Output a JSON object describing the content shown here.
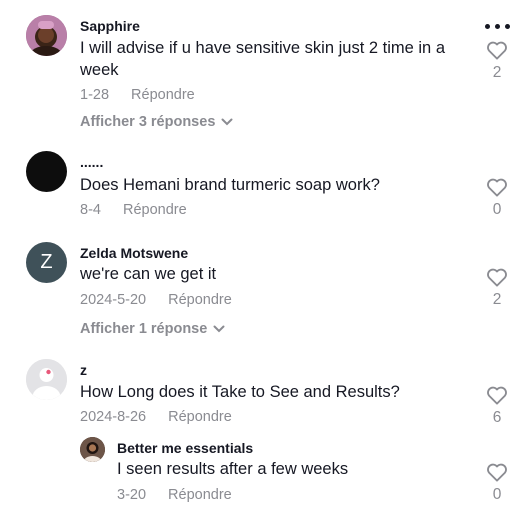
{
  "comments": [
    {
      "username": "Sapphire",
      "text": "I will advise if u have sensitive skin just 2 time in a week",
      "date": "1-28",
      "reply_label": "Répondre",
      "likes": "2",
      "view_replies": "Afficher 3 réponses",
      "avatar_icon": "user-photo"
    },
    {
      "username": "......",
      "text": "Does Hemani brand turmeric soap work?",
      "date": "8-4",
      "reply_label": "Répondre",
      "likes": "0",
      "avatar_icon": "black-circle"
    },
    {
      "username": "Zelda Motswene",
      "avatar_letter": "Z",
      "text": "we're can we get it",
      "date": "2024-5-20",
      "reply_label": "Répondre",
      "likes": "2",
      "view_replies": "Afficher 1 réponse",
      "avatar_color": "#3f5159"
    },
    {
      "username": "z",
      "text": "How Long does it Take to See and Results?",
      "date": "2024-8-26",
      "reply_label": "Répondre",
      "likes": "6",
      "avatar_icon": "default-avatar"
    }
  ],
  "reply": {
    "username": "Better me essentials",
    "text": "I seen results after a few weeks",
    "date": "3-20",
    "reply_label": "Répondre",
    "likes": "0",
    "avatar_icon": "user-photo"
  },
  "colors": {
    "text": "#161823",
    "muted": "#8a8b91",
    "like_outline": "#8a8b91"
  },
  "icons": {
    "more": "more-dots-icon",
    "like": "heart-outline-icon",
    "expand": "chevron-down-icon"
  }
}
